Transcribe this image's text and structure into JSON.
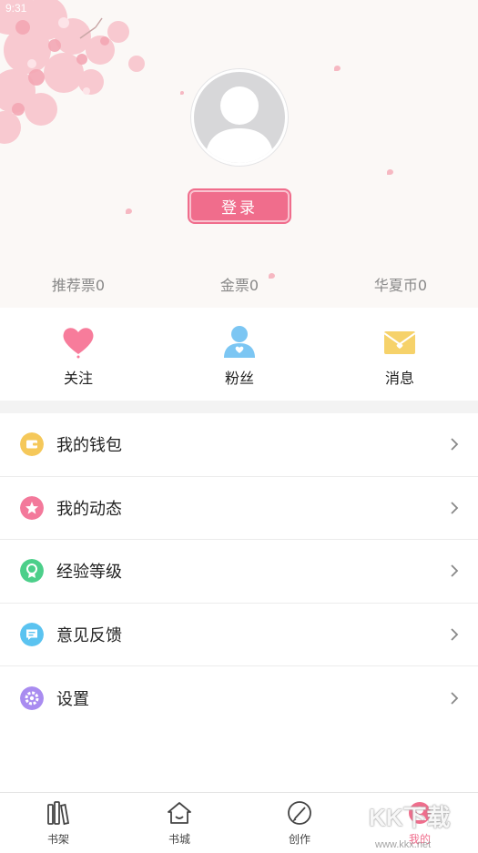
{
  "status_bar": {
    "time": "9:31"
  },
  "profile": {
    "login_label": "登录"
  },
  "stats": [
    {
      "label": "推荐票0"
    },
    {
      "label": "金票0"
    },
    {
      "label": "华夏币0"
    }
  ],
  "quick_actions": [
    {
      "label": "关注",
      "icon": "heart-icon"
    },
    {
      "label": "粉丝",
      "icon": "fans-icon"
    },
    {
      "label": "消息",
      "icon": "envelope-icon"
    }
  ],
  "menu": [
    {
      "label": "我的钱包",
      "icon": "wallet-icon",
      "color": "#f5c85a"
    },
    {
      "label": "我的动态",
      "icon": "star-icon",
      "color": "#f3799b"
    },
    {
      "label": "经验等级",
      "icon": "medal-icon",
      "color": "#4ccf8a"
    },
    {
      "label": "意见反馈",
      "icon": "feedback-icon",
      "color": "#5bc3f0"
    },
    {
      "label": "设置",
      "icon": "settings-icon",
      "color": "#a98cf0"
    }
  ],
  "tabs": [
    {
      "label": "书架",
      "icon": "bookshelf-icon"
    },
    {
      "label": "书城",
      "icon": "store-icon"
    },
    {
      "label": "创作",
      "icon": "create-icon"
    },
    {
      "label": "我的",
      "icon": "profile-icon",
      "active": true
    }
  ],
  "colors": {
    "accent": "#f06d8c",
    "header_bg": "#fbf8f6"
  },
  "watermark": {
    "text": "KK下载",
    "url": "www.kkx.net"
  }
}
